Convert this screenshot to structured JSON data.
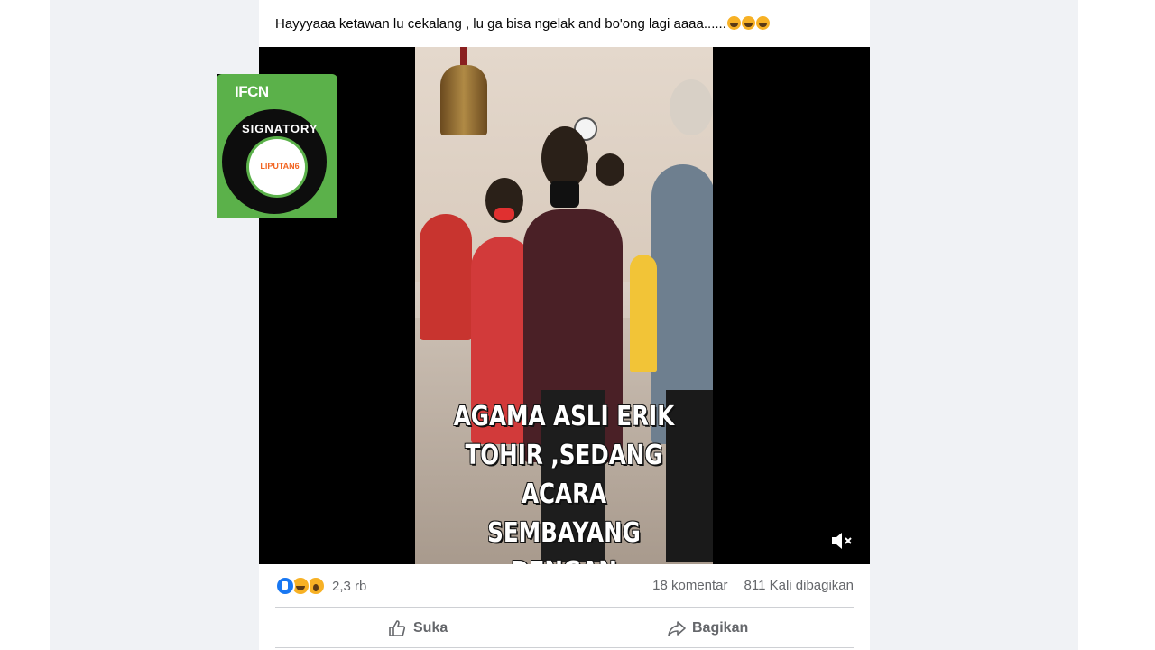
{
  "post": {
    "text": "Hayyyaaa ketawan lu cekalang , lu ga bisa ngelak and bo'ong lagi aaaa......",
    "emojis": [
      "rolling-on-floor-laughing",
      "rolling-on-floor-laughing",
      "rolling-on-floor-laughing"
    ]
  },
  "video": {
    "caption_lines": [
      "AGAMA ASLI ERIK",
      "TOHIR ,SEDANG",
      "ACARA SEMBAYANG",
      "DENGAN KELUARGA"
    ],
    "mute_icon": "speaker-muted-icon"
  },
  "badge": {
    "header": "IFCN",
    "seal_text": "SIGNATORY",
    "logo_text": "LIPUTAN6"
  },
  "footer": {
    "reaction_icons": [
      "like",
      "haha",
      "wow"
    ],
    "reaction_count": "2,3 rb",
    "comments": "18 komentar",
    "shares": "811 Kali dibagikan"
  },
  "actions": {
    "like_label": "Suka",
    "share_label": "Bagikan"
  },
  "colors": {
    "page_bg": "#f0f2f5",
    "badge_green": "#5bb14a",
    "link_blue": "#1877f2",
    "muted_text": "#65676b"
  }
}
